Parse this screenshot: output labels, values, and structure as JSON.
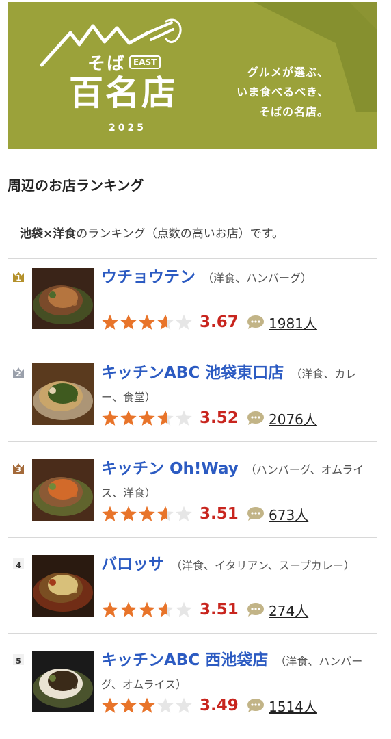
{
  "banner": {
    "soba": "そば",
    "east": "EAST",
    "title": "百名店",
    "year": "2025",
    "tagline": [
      "グルメが選ぶ、",
      "いま食べるべき、",
      "そばの名店。"
    ]
  },
  "section_title": "周辺のお店ランキング",
  "description": {
    "bold": "池袋×洋食",
    "rest": "のランキング（点数の高いお店）です。"
  },
  "colors": {
    "banner_bg": "#9ba23a",
    "link": "#2c5bc2",
    "score": "#c8251e",
    "star_on": "#e8742a",
    "star_off": "#e6e6e6",
    "rank_gold": "#b4912c",
    "rank_silver": "#9aa0ab",
    "rank_bronze": "#a46a3a",
    "rank_plain": "#666666"
  },
  "restaurants": [
    {
      "rank": "1",
      "name": "ウチョウテン",
      "genre": "（洋食、ハンバーグ）",
      "score": "3.67",
      "star_fill": 0.6,
      "reviews": "1981人",
      "photo": "hamburg-steak-photo"
    },
    {
      "rank": "2",
      "name": "キッチンABC 池袋東口店",
      "genre": "（洋食、カレー、食堂）",
      "score": "3.52",
      "star_fill": 0.6,
      "reviews": "2076人",
      "photo": "rice-plate-photo"
    },
    {
      "rank": "3",
      "name": "キッチン Oh!Way",
      "genre": "（ハンバーグ、オムライス、洋食）",
      "score": "3.51",
      "star_fill": 0.6,
      "reviews": "673人",
      "photo": "hamburg-plate-photo"
    },
    {
      "rank": "4",
      "name": "バロッサ",
      "genre": "（洋食、イタリアン、スープカレー）",
      "score": "3.51",
      "star_fill": 0.6,
      "reviews": "274人",
      "photo": "dining-room-photo"
    },
    {
      "rank": "5",
      "name": "キッチンABC 西池袋店",
      "genre": "（洋食、ハンバーグ、オムライス）",
      "score": "3.49",
      "star_fill": 0.0,
      "reviews": "1514人",
      "photo": "black-curry-photo"
    }
  ]
}
